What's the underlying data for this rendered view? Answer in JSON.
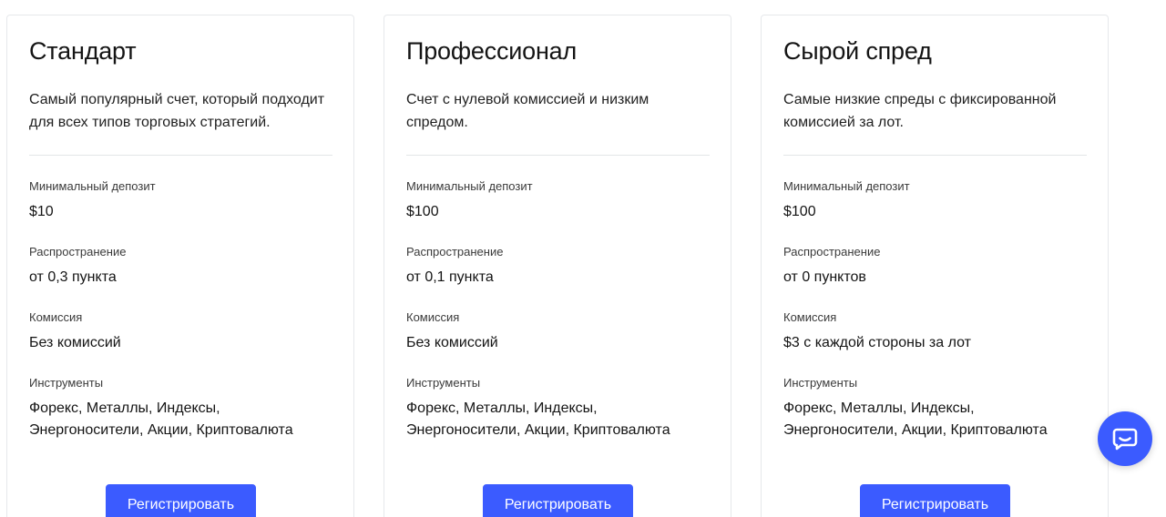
{
  "accent_color": "#3b5bff",
  "plans": [
    {
      "title": "Стандарт",
      "description": "Самый популярный счет, который подходит для всех типов торговых стратегий.",
      "min_deposit_label": "Минимальный депозит",
      "min_deposit_value": "$10",
      "spread_label": "Распространение",
      "spread_value": "от 0,3 пункта",
      "commission_label": "Комиссия",
      "commission_value": "Без комиссий",
      "instruments_label": "Инструменты",
      "instruments_value": "Форекс, Металлы, Индексы, Энергоносители, Акции, Криптовалюта",
      "button_label": "Регистрировать"
    },
    {
      "title": "Профессионал",
      "description": "Счет с нулевой комиссией и низким спредом.",
      "min_deposit_label": "Минимальный депозит",
      "min_deposit_value": "$100",
      "spread_label": "Распространение",
      "spread_value": "от 0,1 пункта",
      "commission_label": "Комиссия",
      "commission_value": "Без комиссий",
      "instruments_label": "Инструменты",
      "instruments_value": "Форекс, Металлы, Индексы, Энергоносители, Акции, Криптовалюта",
      "button_label": "Регистрировать"
    },
    {
      "title": "Сырой спред",
      "description": "Самые низкие спреды с фиксированной комиссией за лот.",
      "min_deposit_label": "Минимальный депозит",
      "min_deposit_value": "$100",
      "spread_label": "Распространение",
      "spread_value": "от 0 пунктов",
      "commission_label": "Комиссия",
      "commission_value": "$3 с каждой стороны за лот",
      "instruments_label": "Инструменты",
      "instruments_value": "Форекс, Металлы, Индексы, Энергоносители, Акции, Криптовалюта",
      "button_label": "Регистрировать"
    }
  ],
  "chat_widget": {
    "icon": "chat-bubble-icon"
  }
}
